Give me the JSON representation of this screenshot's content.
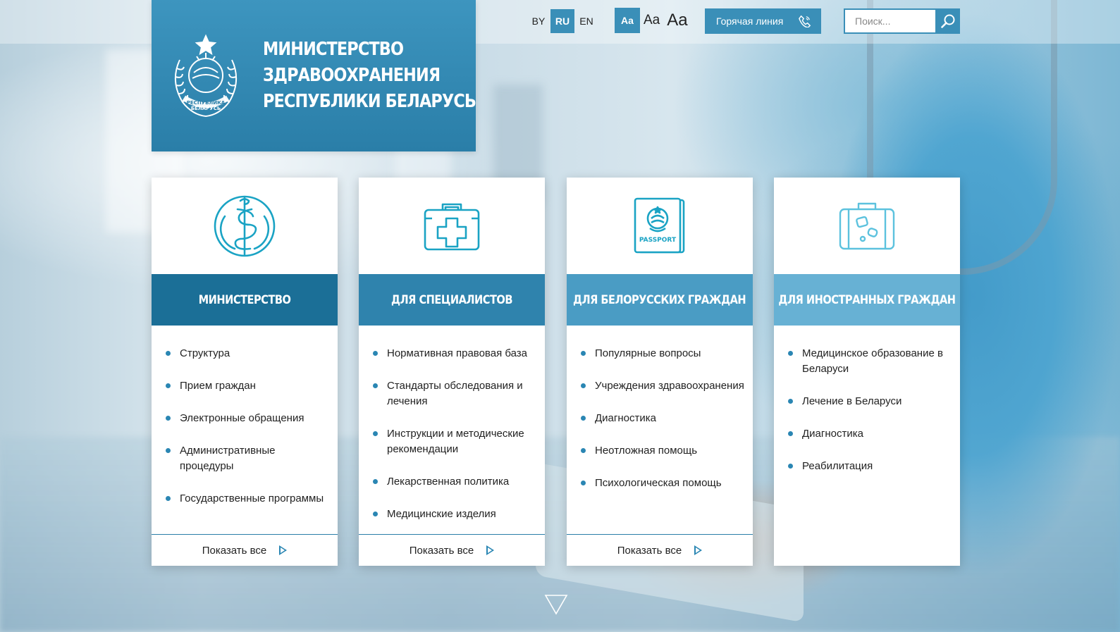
{
  "header": {
    "title_lines": [
      "МИНИСТЕРСТВО",
      "ЗДРАВООХРАНЕНИЯ",
      "РЕСПУБЛИКИ БЕЛАРУСЬ"
    ],
    "emblem_text": [
      "РЕСПУБЛИКА",
      "БЕЛАРУСЬ"
    ],
    "languages": [
      "BY",
      "RU",
      "EN"
    ],
    "active_language": "RU",
    "font_sizes": [
      "Aa",
      "Aa",
      "Aa"
    ],
    "hotline_label": "Горячая линия",
    "search_placeholder": "Поиск..."
  },
  "cards": [
    {
      "title": "МИНИСТЕРСТВО",
      "icon": "caduceus-icon",
      "items": [
        "Структура",
        "Прием граждан",
        "Электронные обращения",
        "Административные процедуры",
        "Государственные программы"
      ],
      "more": "Показать все"
    },
    {
      "title": "ДЛЯ СПЕЦИАЛИСТОВ",
      "icon": "first-aid-kit-icon",
      "items": [
        "Нормативная правовая база",
        "Стандарты обследования и лечения",
        "Инструкции и методические рекомендации",
        "Лекарственная политика",
        "Медицинские изделия"
      ],
      "more": "Показать все"
    },
    {
      "title": "ДЛЯ БЕЛОРУССКИХ ГРАЖДАН",
      "icon": "passport-icon",
      "icon_text": "PASSPORT",
      "items": [
        "Популярные вопросы",
        "Учреждения здравоохранения",
        "Диагностика",
        "Неотложная помощь",
        "Психологическая помощь"
      ],
      "more": "Показать все"
    },
    {
      "title": "ДЛЯ ИНОСТРАННЫХ ГРАЖДАН",
      "icon": "suitcase-icon",
      "items": [
        "Медицинское образование в Беларуси",
        "Лечение в Беларуси",
        "Диагностика",
        "Реабилитация"
      ],
      "more": ""
    }
  ],
  "colors": {
    "accent": "#3a8fb8",
    "band_1": "#1b6f97",
    "band_2": "#2f83ad",
    "band_3": "#4a9cc4",
    "band_4": "#67b1d4",
    "icon": "#1aa3c4"
  }
}
